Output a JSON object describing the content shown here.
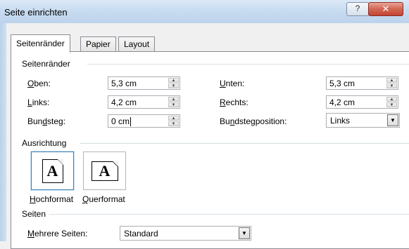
{
  "window": {
    "title": "Seite einrichten",
    "help_label": "?",
    "close_label": "✕"
  },
  "tabs": [
    {
      "label": "Seitenränder",
      "active": true
    },
    {
      "label": "Papier",
      "active": false
    },
    {
      "label": "Layout",
      "active": false
    }
  ],
  "margins": {
    "section_title": "Seitenränder",
    "top": {
      "label_u": "O",
      "label_rest": "ben:",
      "value": "5,3 cm"
    },
    "bottom": {
      "label_u": "U",
      "label_rest": "nten:",
      "value": "5,3 cm"
    },
    "left": {
      "label_u": "L",
      "label_rest": "inks:",
      "value": "4,2 cm"
    },
    "right": {
      "label_u": "R",
      "label_rest": "echts:",
      "value": "4,2 cm"
    },
    "gutter": {
      "label_pre": "Bun",
      "label_u": "d",
      "label_rest": "steg:",
      "value": "0 cm"
    },
    "gutter_position": {
      "label_pre": "Bu",
      "label_u": "n",
      "label_rest": "dstegposition:",
      "value": "Links"
    }
  },
  "orientation": {
    "section_title": "Ausrichtung",
    "portrait": {
      "label_u": "H",
      "label_rest": "ochformat",
      "glyph": "A",
      "selected": true
    },
    "landscape": {
      "label_u": "Q",
      "label_rest": "uerformat",
      "glyph": "A",
      "selected": false
    }
  },
  "pages": {
    "section_title": "Seiten",
    "multiple_pages": {
      "label_u": "M",
      "label_rest": "ehrere Seiten:",
      "value": "Standard"
    }
  },
  "icons": {
    "spin_up": "▲",
    "spin_down": "▼",
    "dropdown": "▼"
  }
}
